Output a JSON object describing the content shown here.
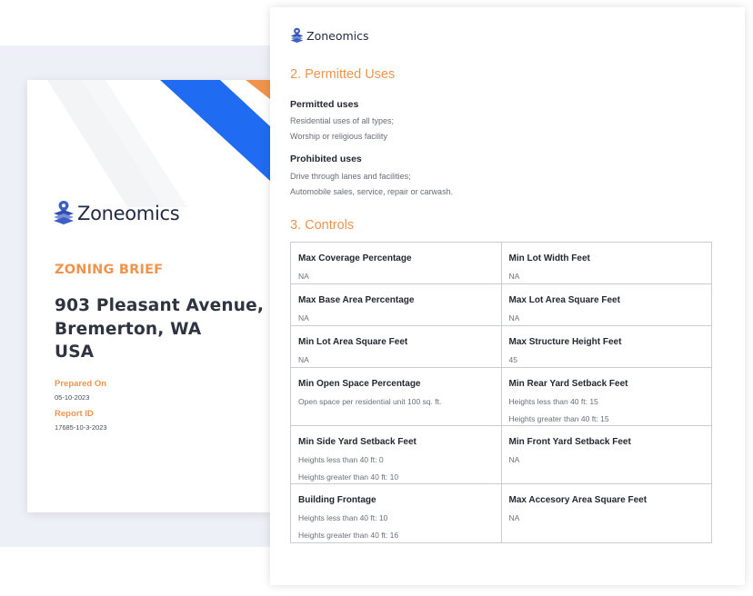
{
  "brand": {
    "name": "Zoneomics",
    "colors": {
      "orange": "#f0944d",
      "blue": "#1f6cf2",
      "navy": "#1f2a44"
    }
  },
  "cover": {
    "heading": "ZONING BRIEF",
    "address_lines": [
      "903 Pleasant Avenue,",
      "Bremerton, WA",
      "USA"
    ],
    "prepared_on_label": "Prepared On",
    "prepared_on_value": "05-10-2023",
    "report_id_label": "Report ID",
    "report_id_value": "17685-10-3-2023"
  },
  "permitted": {
    "section_title": "2. Permitted Uses",
    "permitted_heading": "Permitted uses",
    "permitted_items": [
      "Residential uses of all types;",
      "Worship or religious facility"
    ],
    "prohibited_heading": "Prohibited uses",
    "prohibited_items": [
      "Drive through lanes and facilities;",
      "Automobile sales, service, repair or carwash."
    ]
  },
  "controls": {
    "section_title": "3. Controls",
    "rows": [
      [
        {
          "label": "Max Coverage Percentage",
          "values": [
            "NA"
          ]
        },
        {
          "label": "Min Lot Width Feet",
          "values": [
            "NA"
          ]
        }
      ],
      [
        {
          "label": "Max Base Area Percentage",
          "values": [
            "NA"
          ]
        },
        {
          "label": "Max Lot Area Square Feet",
          "values": [
            "NA"
          ]
        }
      ],
      [
        {
          "label": "Min Lot Area Square Feet",
          "values": [
            "NA"
          ]
        },
        {
          "label": "Max Structure Height Feet",
          "values": [
            "45"
          ]
        }
      ],
      [
        {
          "label": "Min Open Space Percentage",
          "values": [
            "Open space per residential unit 100 sq. ft."
          ]
        },
        {
          "label": "Min Rear Yard Setback Feet",
          "values": [
            "Heights less than 40 ft: 15",
            "Heights greater than 40 ft: 15"
          ]
        }
      ],
      [
        {
          "label": "Min Side Yard Setback Feet",
          "values": [
            "Heights less than 40 ft: 0",
            "Heights greater than 40 ft: 10"
          ]
        },
        {
          "label": "Min Front Yard Setback Feet",
          "values": [
            "NA"
          ]
        }
      ],
      [
        {
          "label": "Building Frontage",
          "values": [
            "Heights less than 40 ft: 10",
            "Heights greater than 40 ft: 16"
          ]
        },
        {
          "label": "Max Accesory Area Square Feet",
          "values": [
            "NA"
          ]
        }
      ]
    ]
  }
}
